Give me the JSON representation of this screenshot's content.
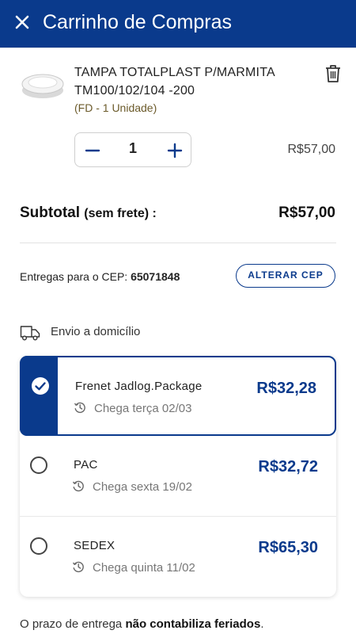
{
  "header": {
    "title": "Carrinho de Compras",
    "close_icon": "close-icon",
    "background": "#0a3a8c"
  },
  "product": {
    "name": "TAMPA TOTALPLAST P/MARMITA TM100/102/104 -200",
    "unit": "(FD - 1 Unidade)",
    "quantity": "1",
    "price": "R$57,00",
    "delete_icon": "trash-icon"
  },
  "subtotal": {
    "label": "Subtotal",
    "note": "(sem frete) :",
    "value": "R$57,00"
  },
  "cep": {
    "label": "Entregas para o CEP:",
    "value": "65071848",
    "button": "ALTERAR CEP"
  },
  "shipping": {
    "title": "Envio a domicílio",
    "options": [
      {
        "name": "Frenet Jadlog.Package",
        "eta": "Chega terça 02/03",
        "cost": "R$32,28",
        "selected": true
      },
      {
        "name": "PAC",
        "eta": "Chega sexta 19/02",
        "cost": "R$32,72",
        "selected": false
      },
      {
        "name": "SEDEX",
        "eta": "Chega quinta 11/02",
        "cost": "R$65,30",
        "selected": false
      }
    ]
  },
  "footer": {
    "text": "O prazo de entrega",
    "bold": "não contabiliza feriados",
    "end": "."
  },
  "colors": {
    "accent": "#0a3a8c"
  }
}
